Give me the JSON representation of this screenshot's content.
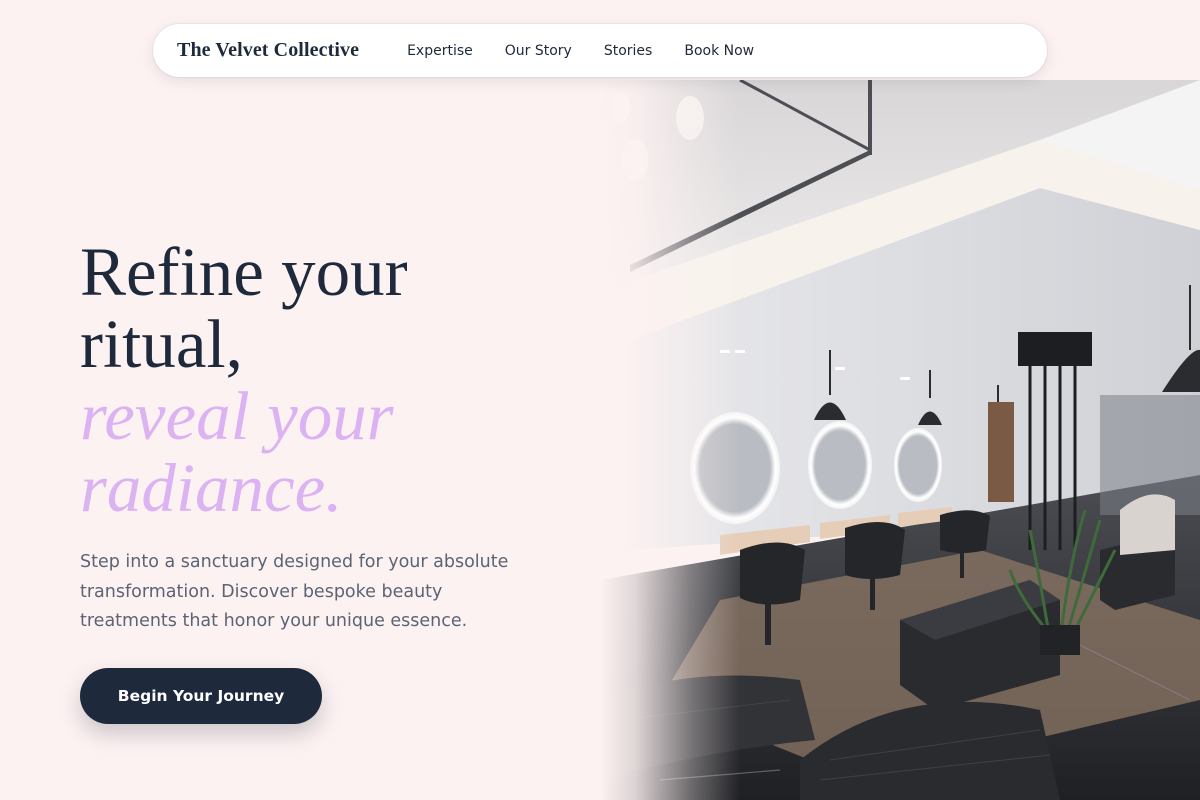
{
  "brand": {
    "name": "The Velvet Collective"
  },
  "nav": {
    "links": [
      "Expertise",
      "Our Story",
      "Stories",
      "Book Now"
    ]
  },
  "hero": {
    "headline_line1": "Refine your",
    "headline_line2": "ritual,",
    "headline_accent_line1": "reveal your",
    "headline_accent_line2": "radiance.",
    "subcopy": "Step into a sanctuary designed for your absolute transformation. Discover bespoke beauty treatments that honor your unique essence.",
    "cta_label": "Begin Your Journey",
    "image_icon": "salon-interior-photo"
  },
  "colors": {
    "background": "#fdf2f2",
    "navy": "#1e293b",
    "accent_lilac": "#dbb2f2",
    "body_text": "#5b6474"
  }
}
